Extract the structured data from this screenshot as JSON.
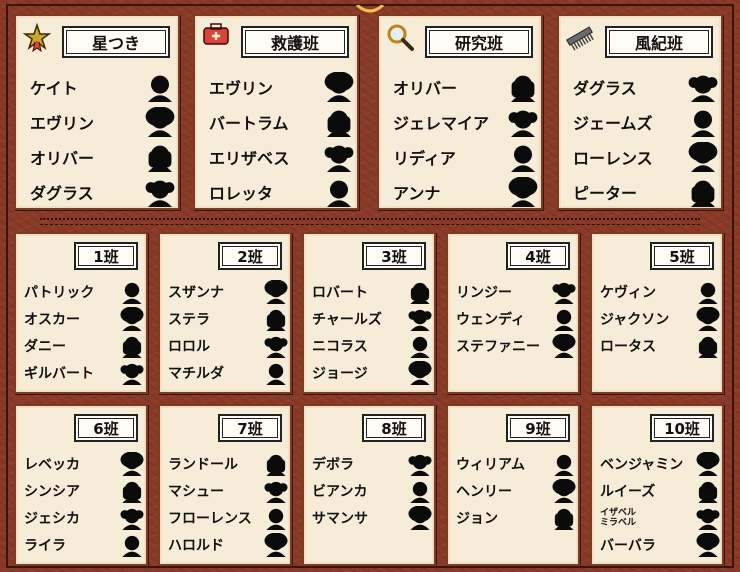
{
  "big_groups": [
    {
      "title": "星つき",
      "icon": "star-badge-icon",
      "members": [
        "ケイト",
        "エヴリン",
        "オリバー",
        "ダグラス"
      ]
    },
    {
      "title": "救護班",
      "icon": "medical-box-icon",
      "members": [
        "エヴリン",
        "バートラム",
        "エリザベス",
        "ロレッタ"
      ]
    },
    {
      "title": "研究班",
      "icon": "magnifying-glass-icon",
      "members": [
        "オリバー",
        "ジェレマイア",
        "リディア",
        "アンナ"
      ]
    },
    {
      "title": "風紀班",
      "icon": "comb-icon",
      "members": [
        "ダグラス",
        "ジェームズ",
        "ローレンス",
        "ピーター"
      ]
    }
  ],
  "small_groups": [
    {
      "title": "1班",
      "members": [
        "パトリック",
        "オスカー",
        "ダニー",
        "ギルバート"
      ]
    },
    {
      "title": "2班",
      "members": [
        "スザンナ",
        "ステラ",
        "ロロル",
        "マチルダ"
      ]
    },
    {
      "title": "3班",
      "members": [
        "ロバート",
        "チャールズ",
        "ニコラス",
        "ジョージ"
      ]
    },
    {
      "title": "4班",
      "members": [
        "リンジー",
        "ウェンディ",
        "ステファニー"
      ]
    },
    {
      "title": "5班",
      "members": [
        "ケヴィン",
        "ジャクソン",
        "ロータス"
      ]
    },
    {
      "title": "6班",
      "members": [
        "レベッカ",
        "シンシア",
        "ジェシカ",
        "ライラ"
      ]
    },
    {
      "title": "7班",
      "members": [
        "ランドール",
        "マシュー",
        "フローレンス",
        "ハロルド"
      ]
    },
    {
      "title": "8班",
      "members": [
        "デボラ",
        "ビアンカ",
        "サマンサ"
      ]
    },
    {
      "title": "9班",
      "members": [
        "ウィリアム",
        "ヘンリー",
        "ジョン"
      ]
    },
    {
      "title": "10班",
      "members": [
        "ベンジャミン",
        "ルイーズ",
        "イザベル",
        "ミラベル",
        "バーバラ"
      ]
    }
  ]
}
